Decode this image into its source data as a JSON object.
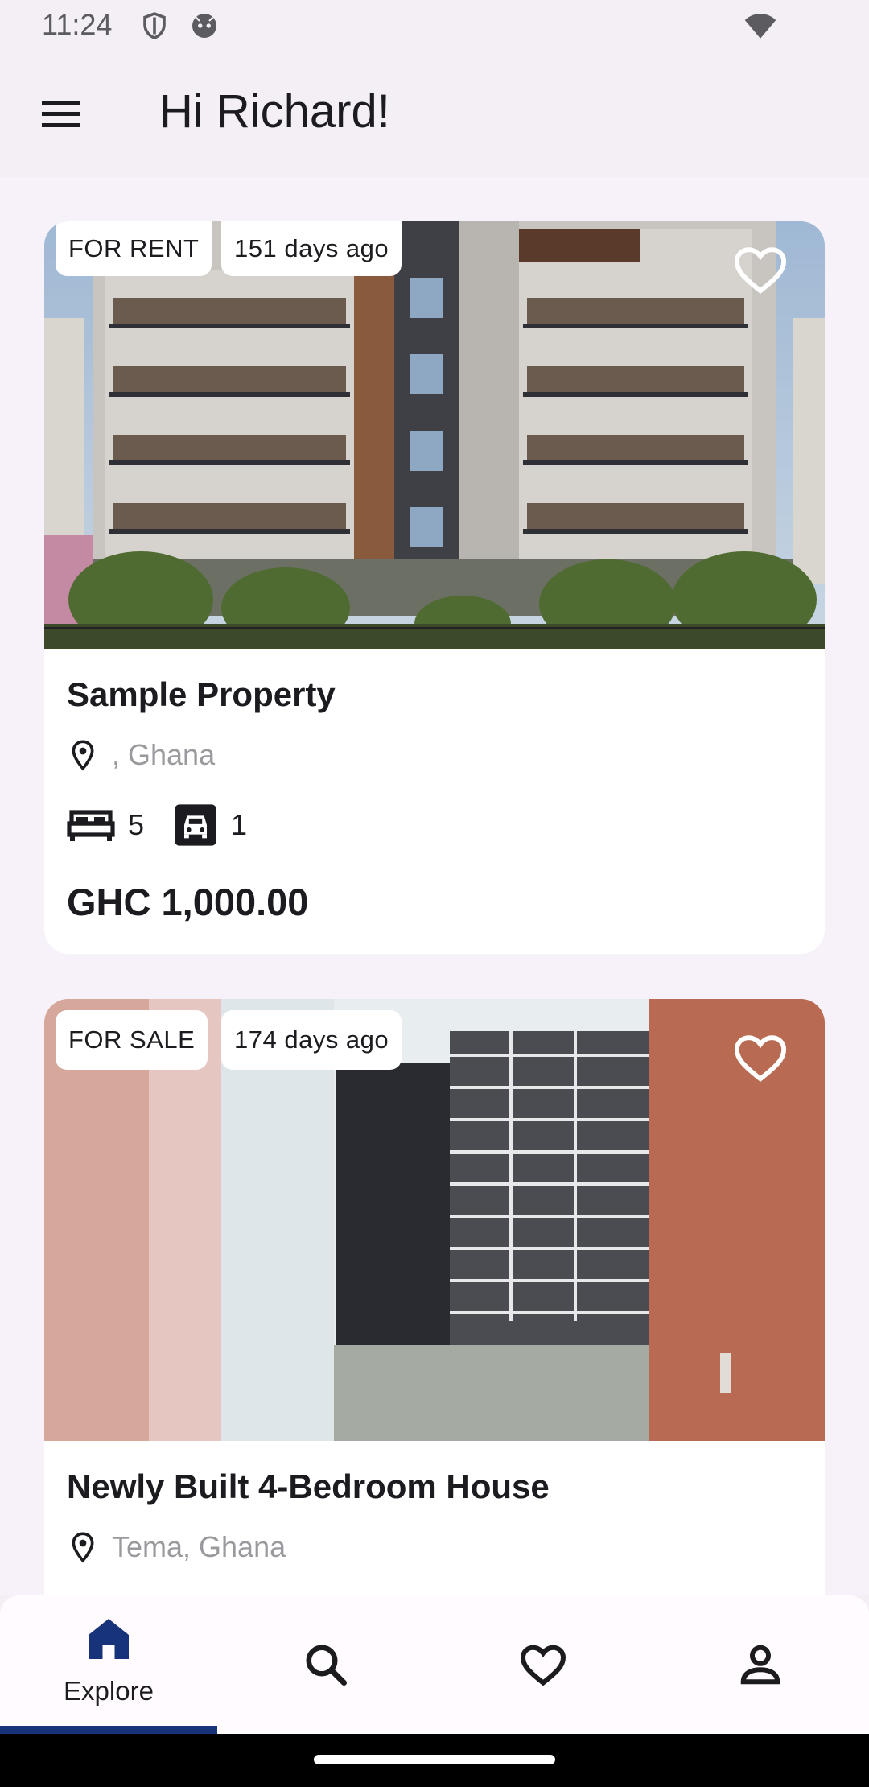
{
  "status_bar": {
    "time": "11:24",
    "icons": [
      "shield-icon",
      "android-icon",
      "wifi-icon"
    ]
  },
  "app_bar": {
    "menu_icon": "hamburger-menu-icon",
    "greeting": "Hi Richard!"
  },
  "listings": [
    {
      "status": "FOR RENT",
      "posted": "151 days ago",
      "title": "Sample Property",
      "location": ", Ghana",
      "bedrooms": "5",
      "garages": "1",
      "price": "GHC 1,000.00",
      "favorited": false
    },
    {
      "status": "FOR SALE",
      "posted": "174 days ago",
      "title": "Newly Built 4-Bedroom House",
      "location": "Tema, Ghana",
      "favorited": false
    }
  ],
  "bottom_nav": {
    "items": [
      {
        "label": "Explore",
        "icon": "home-icon",
        "active": true
      },
      {
        "label": "",
        "icon": "search-icon",
        "active": false
      },
      {
        "label": "",
        "icon": "heart-icon",
        "active": false
      },
      {
        "label": "",
        "icon": "person-icon",
        "active": false
      }
    ],
    "active_color": "#17347a"
  }
}
